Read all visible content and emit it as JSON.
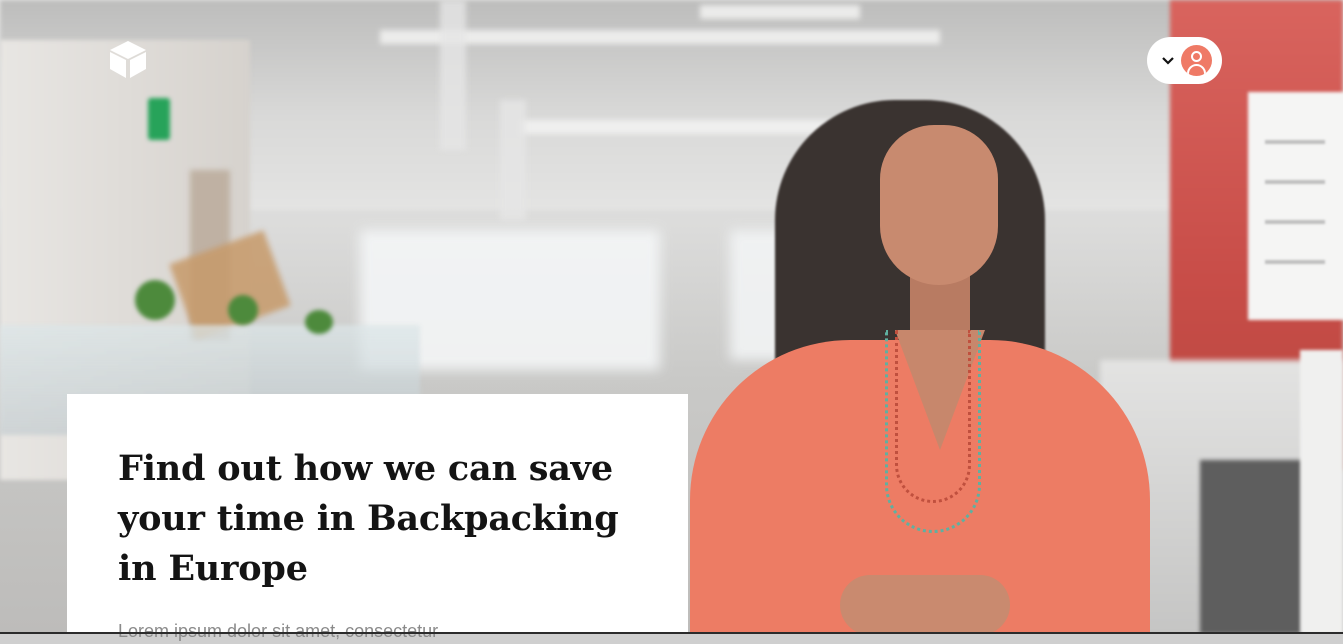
{
  "header": {
    "logo_icon": "cube-logo-icon",
    "user_menu": {
      "chevron_icon": "chevron-down-icon",
      "avatar_icon": "user-avatar-icon",
      "accent_color": "#ef7a66"
    }
  },
  "hero": {
    "image_subject": "office-portrait",
    "card": {
      "headline": "Find out how we can save your time in Backpacking in Europe",
      "lede": "Lorem ipsum dolor sit amet, consectetur"
    }
  },
  "colors": {
    "card_background": "#ffffff",
    "headline_text": "#141414",
    "lede_text": "#8a8a8a",
    "accent": "#ef7a66"
  }
}
